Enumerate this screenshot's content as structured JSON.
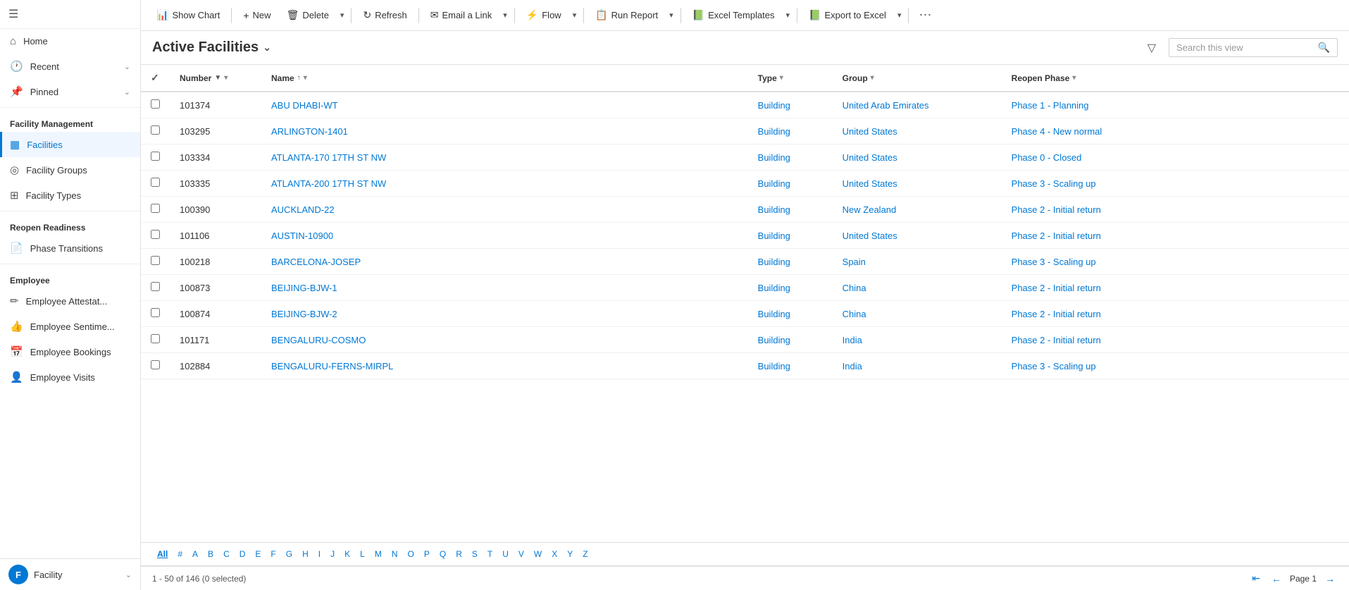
{
  "sidebar": {
    "hamburger_icon": "☰",
    "nav": [
      {
        "id": "home",
        "label": "Home",
        "icon": "⌂",
        "hasChevron": false
      },
      {
        "id": "recent",
        "label": "Recent",
        "icon": "🕐",
        "hasChevron": true
      },
      {
        "id": "pinned",
        "label": "Pinned",
        "icon": "📌",
        "hasChevron": true
      }
    ],
    "sections": [
      {
        "title": "Facility Management",
        "items": [
          {
            "id": "facilities",
            "label": "Facilities",
            "icon": "▦",
            "active": true
          },
          {
            "id": "facility-groups",
            "label": "Facility Groups",
            "icon": "◎"
          },
          {
            "id": "facility-types",
            "label": "Facility Types",
            "icon": "⊞"
          }
        ]
      },
      {
        "title": "Reopen Readiness",
        "items": [
          {
            "id": "phase-transitions",
            "label": "Phase Transitions",
            "icon": "📄"
          }
        ]
      },
      {
        "title": "Employee",
        "items": [
          {
            "id": "employee-attest",
            "label": "Employee Attestat...",
            "icon": "✏"
          },
          {
            "id": "employee-sentimen",
            "label": "Employee Sentime...",
            "icon": "👍"
          },
          {
            "id": "employee-bookings",
            "label": "Employee Bookings",
            "icon": "📅"
          },
          {
            "id": "employee-visits",
            "label": "Employee Visits",
            "icon": "👤"
          }
        ]
      }
    ],
    "footer": {
      "avatar_letter": "F",
      "label": "Facility",
      "chevron": "⌄"
    }
  },
  "toolbar": {
    "buttons": [
      {
        "id": "show-chart",
        "icon": "📊",
        "label": "Show Chart",
        "hasChevron": false
      },
      {
        "id": "new",
        "icon": "+",
        "label": "New",
        "hasChevron": false
      },
      {
        "id": "delete",
        "icon": "🗑",
        "label": "Delete",
        "hasChevron": true
      },
      {
        "id": "refresh",
        "icon": "↻",
        "label": "Refresh",
        "hasChevron": false
      },
      {
        "id": "email-link",
        "icon": "✉",
        "label": "Email a Link",
        "hasChevron": true
      },
      {
        "id": "flow",
        "icon": "⚡",
        "label": "Flow",
        "hasChevron": true
      },
      {
        "id": "run-report",
        "icon": "📋",
        "label": "Run Report",
        "hasChevron": true
      },
      {
        "id": "excel-templates",
        "icon": "📗",
        "label": "Excel Templates",
        "hasChevron": true
      },
      {
        "id": "export-excel",
        "icon": "📗",
        "label": "Export to Excel",
        "hasChevron": true
      }
    ],
    "more_icon": "⋯"
  },
  "view": {
    "title": "Active Facilities",
    "title_chevron": "⌄",
    "filter_icon": "▽",
    "search_placeholder": "Search this view",
    "search_icon": "🔍"
  },
  "table": {
    "columns": [
      {
        "id": "check",
        "label": ""
      },
      {
        "id": "number",
        "label": "Number",
        "sort": "▼",
        "hasChevron": true
      },
      {
        "id": "name",
        "label": "Name",
        "sort": "↑",
        "hasChevron": true
      },
      {
        "id": "type",
        "label": "Type",
        "sort": "",
        "hasChevron": true
      },
      {
        "id": "group",
        "label": "Group",
        "sort": "",
        "hasChevron": true
      },
      {
        "id": "reopen_phase",
        "label": "Reopen Phase",
        "sort": "",
        "hasChevron": true
      }
    ],
    "rows": [
      {
        "number": "101374",
        "name": "ABU DHABI-WT",
        "type": "Building",
        "group": "United Arab Emirates",
        "reopen_phase": "Phase 1 - Planning"
      },
      {
        "number": "103295",
        "name": "ARLINGTON-1401",
        "type": "Building",
        "group": "United States",
        "reopen_phase": "Phase 4 - New normal"
      },
      {
        "number": "103334",
        "name": "ATLANTA-170 17TH ST NW",
        "type": "Building",
        "group": "United States",
        "reopen_phase": "Phase 0 - Closed"
      },
      {
        "number": "103335",
        "name": "ATLANTA-200 17TH ST NW",
        "type": "Building",
        "group": "United States",
        "reopen_phase": "Phase 3 - Scaling up"
      },
      {
        "number": "100390",
        "name": "AUCKLAND-22",
        "type": "Building",
        "group": "New Zealand",
        "reopen_phase": "Phase 2 - Initial return"
      },
      {
        "number": "101106",
        "name": "AUSTIN-10900",
        "type": "Building",
        "group": "United States",
        "reopen_phase": "Phase 2 - Initial return"
      },
      {
        "number": "100218",
        "name": "BARCELONA-JOSEP",
        "type": "Building",
        "group": "Spain",
        "reopen_phase": "Phase 3 - Scaling up"
      },
      {
        "number": "100873",
        "name": "BEIJING-BJW-1",
        "type": "Building",
        "group": "China",
        "reopen_phase": "Phase 2 - Initial return"
      },
      {
        "number": "100874",
        "name": "BEIJING-BJW-2",
        "type": "Building",
        "group": "China",
        "reopen_phase": "Phase 2 - Initial return"
      },
      {
        "number": "101171",
        "name": "BENGALURU-COSMO",
        "type": "Building",
        "group": "India",
        "reopen_phase": "Phase 2 - Initial return"
      },
      {
        "number": "102884",
        "name": "BENGALURU-FERNS-MIRPL",
        "type": "Building",
        "group": "India",
        "reopen_phase": "Phase 3 - Scaling up"
      }
    ]
  },
  "alpha_nav": {
    "items": [
      "All",
      "#",
      "A",
      "B",
      "C",
      "D",
      "E",
      "F",
      "G",
      "H",
      "I",
      "J",
      "K",
      "L",
      "M",
      "N",
      "O",
      "P",
      "Q",
      "R",
      "S",
      "T",
      "U",
      "V",
      "W",
      "X",
      "Y",
      "Z"
    ],
    "active": "All"
  },
  "footer": {
    "summary": "1 - 50 of 146 (0 selected)",
    "page_label": "Page 1",
    "first_icon": "⇤",
    "prev_icon": "←",
    "next_icon": "→"
  }
}
